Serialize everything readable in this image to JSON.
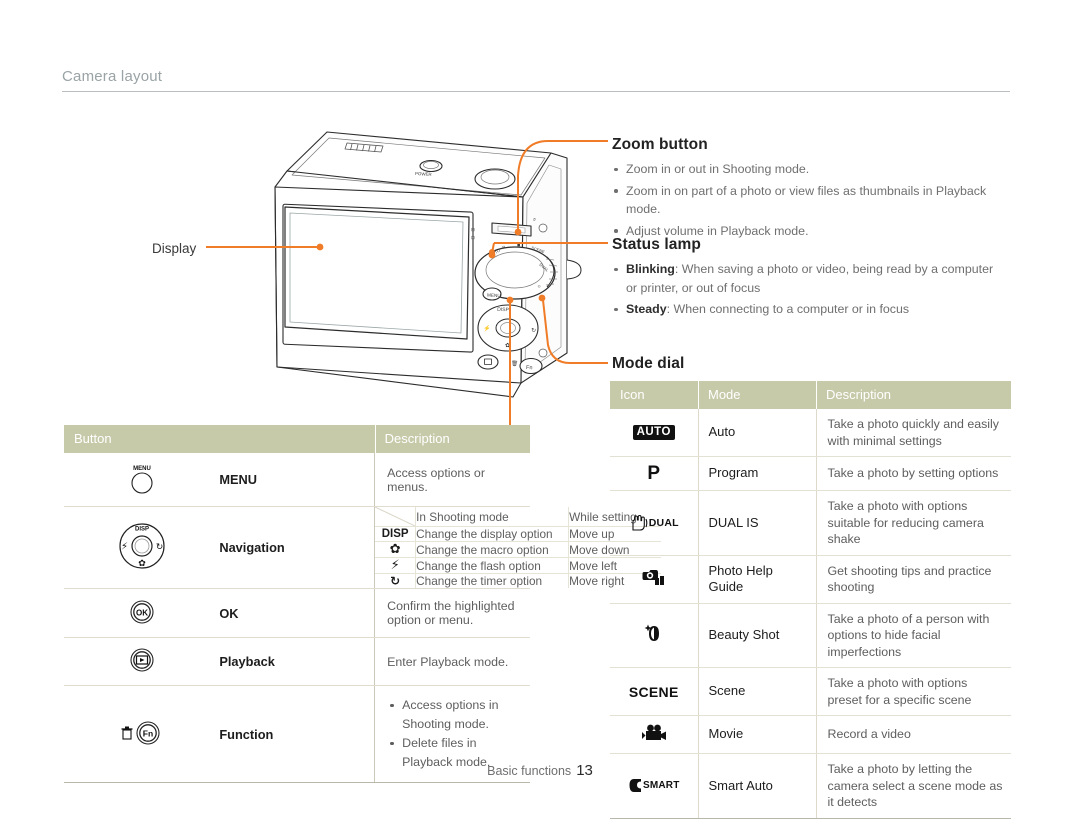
{
  "header": {
    "chapter": "Camera layout"
  },
  "diagram": {
    "display_label": "Display",
    "accent_color": "#f07c28"
  },
  "callouts": [
    {
      "id": "zoom",
      "title": "Zoom button",
      "items": [
        {
          "text": "Zoom in or out in Shooting mode."
        },
        {
          "text": "Zoom in on part of a photo or view files as thumbnails in Playback mode."
        },
        {
          "text": "Adjust volume in Playback mode."
        }
      ]
    },
    {
      "id": "status",
      "title": "Status lamp",
      "items": [
        {
          "bold": "Blinking",
          "text": ": When saving a photo or video, being read by a computer",
          "cont": "or printer, or out of focus"
        },
        {
          "bold": "Steady",
          "text": ": When connecting to a computer or in focus"
        }
      ]
    },
    {
      "id": "mode",
      "title": "Mode dial"
    }
  ],
  "button_table": {
    "headers": {
      "button": "Button",
      "description": "Description"
    },
    "rows": [
      {
        "icon": "menu-button-icon",
        "icon_label": "MENU",
        "name": "MENU",
        "description": "Access options or menus."
      },
      {
        "icon": "navigation-pad-icon",
        "name": "Navigation",
        "sub_table": {
          "headers": {
            "corner": "",
            "shooting": "In Shooting mode",
            "setting": "While setting"
          },
          "rows": [
            {
              "key": "DISP",
              "key_icon": "disp-icon",
              "shooting": "Change the display option",
              "setting": "Move up"
            },
            {
              "key": "",
              "key_icon": "macro-flower-icon",
              "shooting": "Change the macro option",
              "setting": "Move down"
            },
            {
              "key": "",
              "key_icon": "flash-bolt-icon",
              "shooting": "Change the flash option",
              "setting": "Move left"
            },
            {
              "key": "",
              "key_icon": "timer-clock-icon",
              "shooting": "Change the timer option",
              "setting": "Move right"
            }
          ]
        }
      },
      {
        "icon": "ok-button-icon",
        "icon_label": "OK",
        "name": "OK",
        "description": "Confirm the highlighted option or menu."
      },
      {
        "icon": "playback-button-icon",
        "name": "Playback",
        "description": "Enter Playback mode."
      },
      {
        "icon": "function-button-icon",
        "icon_label": "Fn",
        "name": "Function",
        "bullets": [
          "Access options in Shooting mode.",
          "Delete files in Playback mode."
        ]
      }
    ]
  },
  "mode_table": {
    "headers": {
      "icon": "Icon",
      "mode": "Mode",
      "description": "Description"
    },
    "rows": [
      {
        "icon_name": "auto-mode-icon",
        "icon_text": "AUTO",
        "icon_style": "auto",
        "mode": "Auto",
        "description": "Take a photo quickly and easily with minimal settings"
      },
      {
        "icon_name": "program-mode-icon",
        "icon_text": "P",
        "icon_style": "p",
        "mode": "Program",
        "description": "Take a photo by setting options"
      },
      {
        "icon_name": "dual-is-mode-icon",
        "icon_text": "DUAL",
        "icon_style": "dual",
        "mode": "DUAL IS",
        "description": "Take a photo with options suitable for reducing camera shake"
      },
      {
        "icon_name": "photo-help-guide-mode-icon",
        "icon_text": "",
        "icon_style": "helpguide",
        "mode": "Photo Help Guide",
        "description": "Get shooting tips and practice shooting"
      },
      {
        "icon_name": "beauty-shot-mode-icon",
        "icon_text": "",
        "icon_style": "beauty",
        "mode": "Beauty Shot",
        "description": "Take a photo of a person with options to hide facial imperfections"
      },
      {
        "icon_name": "scene-mode-icon",
        "icon_text": "SCENE",
        "icon_style": "scene",
        "mode": "Scene",
        "description": "Take a photo with options preset for a specific scene"
      },
      {
        "icon_name": "movie-mode-icon",
        "icon_text": "",
        "icon_style": "movie",
        "mode": "Movie",
        "description": "Record a video"
      },
      {
        "icon_name": "smart-auto-mode-icon",
        "icon_text": "SMART",
        "icon_style": "smart",
        "mode": "Smart Auto",
        "description": "Take a photo by letting the camera select a scene mode as it detects"
      }
    ]
  },
  "footer": {
    "section": "Basic functions",
    "page": "13"
  },
  "colors": {
    "accent": "#f07c28",
    "table_header": "#c7caa9",
    "body_text": "#5e5e5e",
    "title_text": "#222222",
    "chapter_text": "#9aa3a6"
  }
}
